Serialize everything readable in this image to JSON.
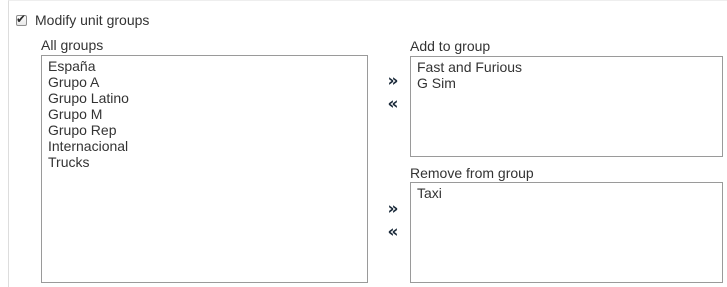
{
  "modify": {
    "checked": true,
    "label": "Modify unit groups"
  },
  "all_groups": {
    "label": "All groups",
    "items": [
      "España",
      "Grupo A",
      "Grupo Latino",
      "Grupo M",
      "Grupo Rep",
      "Internacional",
      "Trucks"
    ]
  },
  "add_group": {
    "label": "Add to group",
    "items": [
      "Fast and Furious",
      "G Sim"
    ],
    "move_right_glyph": "»",
    "move_left_glyph": "«"
  },
  "remove_group": {
    "label": "Remove from group",
    "items": [
      "Taxi"
    ],
    "move_right_glyph": "»",
    "move_left_glyph": "«"
  },
  "icons": {
    "checkbox": "checkmark-icon",
    "move_right": "double-chevron-right-icon",
    "move_left": "double-chevron-left-icon"
  }
}
